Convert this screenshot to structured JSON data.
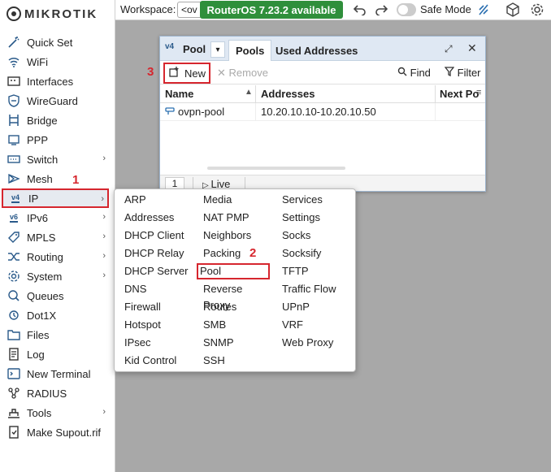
{
  "brand": {
    "name": "MIKROTIK"
  },
  "sidebar": {
    "items": [
      {
        "label": "Quick Set",
        "icon": "wand-icon",
        "has_submenu": false
      },
      {
        "label": "WiFi",
        "icon": "wifi-icon",
        "has_submenu": false
      },
      {
        "label": "Interfaces",
        "icon": "interfaces-icon",
        "has_submenu": false
      },
      {
        "label": "WireGuard",
        "icon": "wireguard-icon",
        "has_submenu": false
      },
      {
        "label": "Bridge",
        "icon": "bridge-icon",
        "has_submenu": false
      },
      {
        "label": "PPP",
        "icon": "ppp-icon",
        "has_submenu": false
      },
      {
        "label": "Switch",
        "icon": "switch-icon",
        "has_submenu": true
      },
      {
        "label": "Mesh",
        "icon": "mesh-icon",
        "has_submenu": false
      },
      {
        "label": "IP",
        "icon": "ipv4-icon",
        "has_submenu": true,
        "active": true
      },
      {
        "label": "IPv6",
        "icon": "ipv6-icon",
        "has_submenu": true
      },
      {
        "label": "MPLS",
        "icon": "mpls-icon",
        "has_submenu": true
      },
      {
        "label": "Routing",
        "icon": "routing-icon",
        "has_submenu": true
      },
      {
        "label": "System",
        "icon": "gear-icon",
        "has_submenu": true
      },
      {
        "label": "Queues",
        "icon": "queues-icon",
        "has_submenu": false
      },
      {
        "label": "Dot1X",
        "icon": "dot1x-icon",
        "has_submenu": false
      },
      {
        "label": "Files",
        "icon": "folder-icon",
        "has_submenu": false
      },
      {
        "label": "Log",
        "icon": "log-icon",
        "has_submenu": false
      },
      {
        "label": "New Terminal",
        "icon": "terminal-icon",
        "has_submenu": false
      },
      {
        "label": "RADIUS",
        "icon": "radius-icon",
        "has_submenu": false
      },
      {
        "label": "Tools",
        "icon": "tools-icon",
        "has_submenu": true
      },
      {
        "label": "Make Supout.rif",
        "icon": "supout-icon",
        "has_submenu": false
      }
    ]
  },
  "topbar": {
    "workspace_label": "Workspace:",
    "workspace_value": "<ov",
    "update_badge": "RouterOS 7.23.2 available",
    "safe_mode_label": "Safe Mode"
  },
  "pool_window": {
    "v4_badge": "v4",
    "title": "Pool",
    "tabs": [
      "Pools",
      "Used Addresses"
    ],
    "toolbar": {
      "new": "New",
      "remove": "Remove",
      "find": "Find",
      "filter": "Filter"
    },
    "columns": [
      "Name",
      "Addresses",
      "Next Po"
    ],
    "rows": [
      {
        "name": "ovpn-pool",
        "addresses": "10.20.10.10-10.20.10.50",
        "next_pool": ""
      }
    ],
    "status": {
      "count": "1",
      "live": "Live"
    }
  },
  "ip_menu": {
    "columns": [
      [
        "ARP",
        "Addresses",
        "DHCP Client",
        "DHCP Relay",
        "DHCP Server",
        "DNS",
        "Firewall",
        "Hotspot",
        "IPsec",
        "Kid Control"
      ],
      [
        "Media",
        "NAT PMP",
        "Neighbors",
        "Packing",
        "Pool",
        "Reverse Proxy",
        "Routes",
        "SMB",
        "SNMP",
        "SSH"
      ],
      [
        "Services",
        "Settings",
        "Socks",
        "Socksify",
        "TFTP",
        "Traffic Flow",
        "UPnP",
        "VRF",
        "Web Proxy"
      ]
    ],
    "highlighted": "Pool"
  },
  "steps": [
    "1",
    "2",
    "3"
  ],
  "colors": {
    "highlight": "#d6262e",
    "update_badge": "#2f8f3b",
    "title_bar": "#dfe8f3",
    "desktop": "#a8a8a8"
  }
}
